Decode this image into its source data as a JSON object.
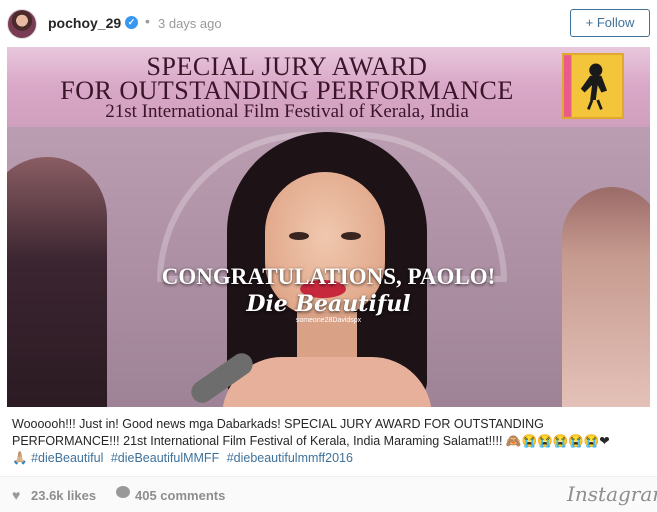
{
  "post": {
    "username": "pochoy_29",
    "time": "3 days ago",
    "follow_label": "+ Follow"
  },
  "photo": {
    "banner_line1": "SPECIAL JURY AWARD",
    "banner_line2": "FOR OUTSTANDING PERFORMANCE",
    "banner_line3": "21st International Film Festival of Kerala, India",
    "congrats": "CONGRATULATIONS, PAOLO!",
    "movie_title": "Die Beautiful",
    "credit": "someone28Davidspx",
    "festival_logo_icon": "festival-logo-icon"
  },
  "caption": {
    "text": "Woooooh!!! Just in! Good news mga Dabarkads! SPECIAL JURY AWARD FOR OUTSTANDING PERFORMANCE!!! 21st International Film Festival of Kerala, India Maraming Salamat!!!! 🙈😭😭😭😭😭❤",
    "emoji_prefix": "🙏🏼",
    "hashtags": [
      "#dieBeautiful",
      "#dieBeautifulMMFF",
      "#diebeautifulmmff2016"
    ]
  },
  "footer": {
    "likes": "23.6k likes",
    "comments": "405 comments",
    "brand": "Instagram",
    "heart_icon": "heart-icon",
    "comment_icon": "comment-icon"
  },
  "colors": {
    "link": "#3f729b",
    "verified": "#3897f0",
    "text": "#262626",
    "muted": "#8e8e8e"
  }
}
